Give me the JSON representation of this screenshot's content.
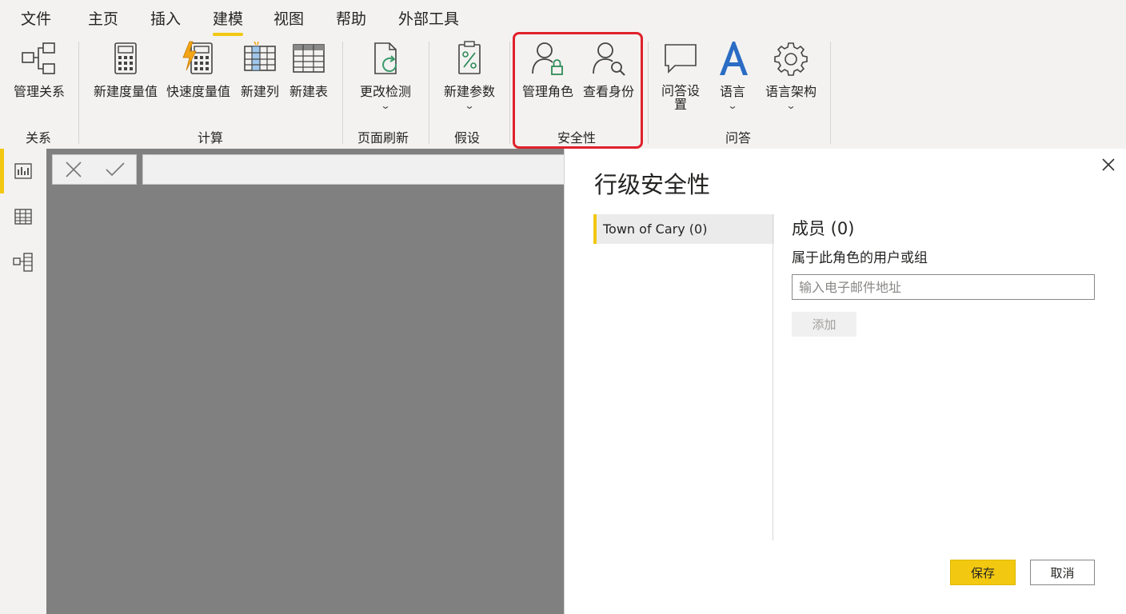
{
  "menu": {
    "tabs": [
      {
        "label": "文件"
      },
      {
        "label": "主页"
      },
      {
        "label": "插入"
      },
      {
        "label": "建模"
      },
      {
        "label": "视图"
      },
      {
        "label": "帮助"
      },
      {
        "label": "外部工具"
      }
    ],
    "active": "建模"
  },
  "ribbon": {
    "groups": {
      "relationships": "关系",
      "calculations": "计算",
      "page_refresh": "页面刷新",
      "whatif": "假设",
      "security": "安全性",
      "qa": "问答"
    },
    "buttons": {
      "manage_relationships": "管理关系",
      "new_measure": "新建度量值",
      "quick_measure": "快速度量值",
      "new_column": "新建列",
      "new_table": "新建表",
      "change_detection": "更改检测",
      "new_parameter": "新建参数",
      "manage_roles": "管理角色",
      "view_as": "查看身份",
      "qa_setup_line1": "问答设",
      "qa_setup_line2": "置",
      "language": "语言",
      "linguistic_schema": "语言架构"
    },
    "highlight_color": "#e0212b"
  },
  "dialog": {
    "title": "行级安全性",
    "role": "Town of Cary (0)",
    "members_title": "成员 (0)",
    "members_subtitle": "属于此角色的用户或组",
    "email_placeholder": "输入电子邮件地址",
    "add_label": "添加",
    "save_label": "保存",
    "cancel_label": "取消"
  },
  "colors": {
    "accent": "#f2c811",
    "canvas": "#808080"
  }
}
